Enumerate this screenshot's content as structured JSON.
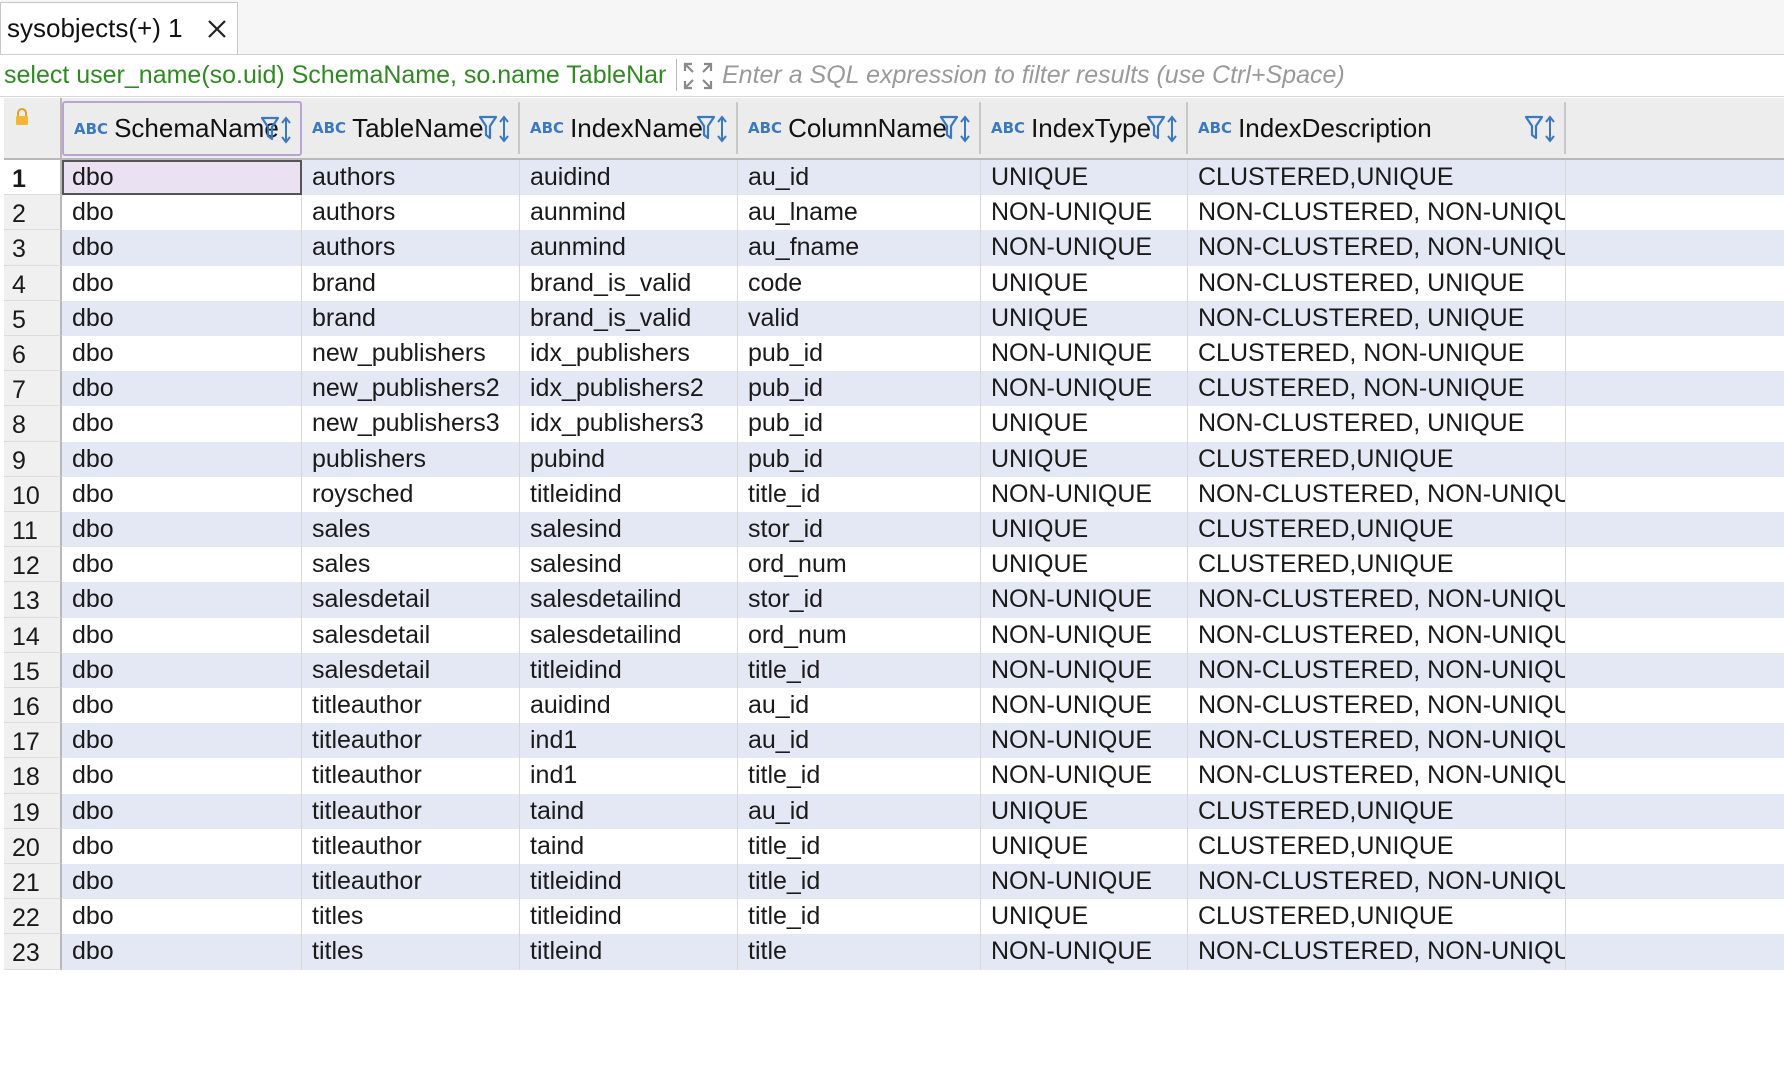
{
  "tab": {
    "label": "sysobjects(+) 1"
  },
  "query": {
    "sql": "select user_name(so.uid) SchemaName, so.name TableName, si.name IndexName, sc.name ColumnName",
    "filter_placeholder": "Enter a SQL expression to filter results (use Ctrl+Space)"
  },
  "grid": {
    "type_badge": "ABC",
    "columns": [
      "SchemaName",
      "TableName",
      "IndexName",
      "ColumnName",
      "IndexType",
      "IndexDescription"
    ],
    "rows": [
      [
        "1",
        "dbo",
        "authors",
        "auidind",
        "au_id",
        "UNIQUE",
        "CLUSTERED,UNIQUE"
      ],
      [
        "2",
        "dbo",
        "authors",
        "aunmind",
        "au_lname",
        "NON-UNIQUE",
        "NON-CLUSTERED, NON-UNIQUE"
      ],
      [
        "3",
        "dbo",
        "authors",
        "aunmind",
        "au_fname",
        "NON-UNIQUE",
        "NON-CLUSTERED, NON-UNIQUE"
      ],
      [
        "4",
        "dbo",
        "brand",
        "brand_is_valid",
        "code",
        "UNIQUE",
        "NON-CLUSTERED, UNIQUE"
      ],
      [
        "5",
        "dbo",
        "brand",
        "brand_is_valid",
        "valid",
        "UNIQUE",
        "NON-CLUSTERED, UNIQUE"
      ],
      [
        "6",
        "dbo",
        "new_publishers",
        "idx_publishers",
        "pub_id",
        "NON-UNIQUE",
        "CLUSTERED, NON-UNIQUE"
      ],
      [
        "7",
        "dbo",
        "new_publishers2",
        "idx_publishers2",
        "pub_id",
        "NON-UNIQUE",
        "CLUSTERED, NON-UNIQUE"
      ],
      [
        "8",
        "dbo",
        "new_publishers3",
        "idx_publishers3",
        "pub_id",
        "UNIQUE",
        "NON-CLUSTERED, UNIQUE"
      ],
      [
        "9",
        "dbo",
        "publishers",
        "pubind",
        "pub_id",
        "UNIQUE",
        "CLUSTERED,UNIQUE"
      ],
      [
        "10",
        "dbo",
        "roysched",
        "titleidind",
        "title_id",
        "NON-UNIQUE",
        "NON-CLUSTERED, NON-UNIQUE"
      ],
      [
        "11",
        "dbo",
        "sales",
        "salesind",
        "stor_id",
        "UNIQUE",
        "CLUSTERED,UNIQUE"
      ],
      [
        "12",
        "dbo",
        "sales",
        "salesind",
        "ord_num",
        "UNIQUE",
        "CLUSTERED,UNIQUE"
      ],
      [
        "13",
        "dbo",
        "salesdetail",
        "salesdetailind",
        "stor_id",
        "NON-UNIQUE",
        "NON-CLUSTERED, NON-UNIQUE"
      ],
      [
        "14",
        "dbo",
        "salesdetail",
        "salesdetailind",
        "ord_num",
        "NON-UNIQUE",
        "NON-CLUSTERED, NON-UNIQUE"
      ],
      [
        "15",
        "dbo",
        "salesdetail",
        "titleidind",
        "title_id",
        "NON-UNIQUE",
        "NON-CLUSTERED, NON-UNIQUE"
      ],
      [
        "16",
        "dbo",
        "titleauthor",
        "auidind",
        "au_id",
        "NON-UNIQUE",
        "NON-CLUSTERED, NON-UNIQUE"
      ],
      [
        "17",
        "dbo",
        "titleauthor",
        "ind1",
        "au_id",
        "NON-UNIQUE",
        "NON-CLUSTERED, NON-UNIQUE"
      ],
      [
        "18",
        "dbo",
        "titleauthor",
        "ind1",
        "title_id",
        "NON-UNIQUE",
        "NON-CLUSTERED, NON-UNIQUE"
      ],
      [
        "19",
        "dbo",
        "titleauthor",
        "taind",
        "au_id",
        "UNIQUE",
        "CLUSTERED,UNIQUE"
      ],
      [
        "20",
        "dbo",
        "titleauthor",
        "taind",
        "title_id",
        "UNIQUE",
        "CLUSTERED,UNIQUE"
      ],
      [
        "21",
        "dbo",
        "titleauthor",
        "titleidind",
        "title_id",
        "NON-UNIQUE",
        "NON-CLUSTERED, NON-UNIQUE"
      ],
      [
        "22",
        "dbo",
        "titles",
        "titleidind",
        "title_id",
        "UNIQUE",
        "CLUSTERED,UNIQUE"
      ],
      [
        "23",
        "dbo",
        "titles",
        "titleind",
        "title",
        "NON-UNIQUE",
        "NON-CLUSTERED, NON-UNIQUE"
      ]
    ]
  },
  "icons": {
    "tab_close": "close-icon",
    "expand": "expand-icon",
    "lock": "lock-icon",
    "column_tools": "filter-sort-icon"
  },
  "colors": {
    "query_text": "#2e8b20",
    "alt_row": "#e3e8f4",
    "type_badge": "#3a78c4",
    "selected_cell": "#eae2f3"
  }
}
